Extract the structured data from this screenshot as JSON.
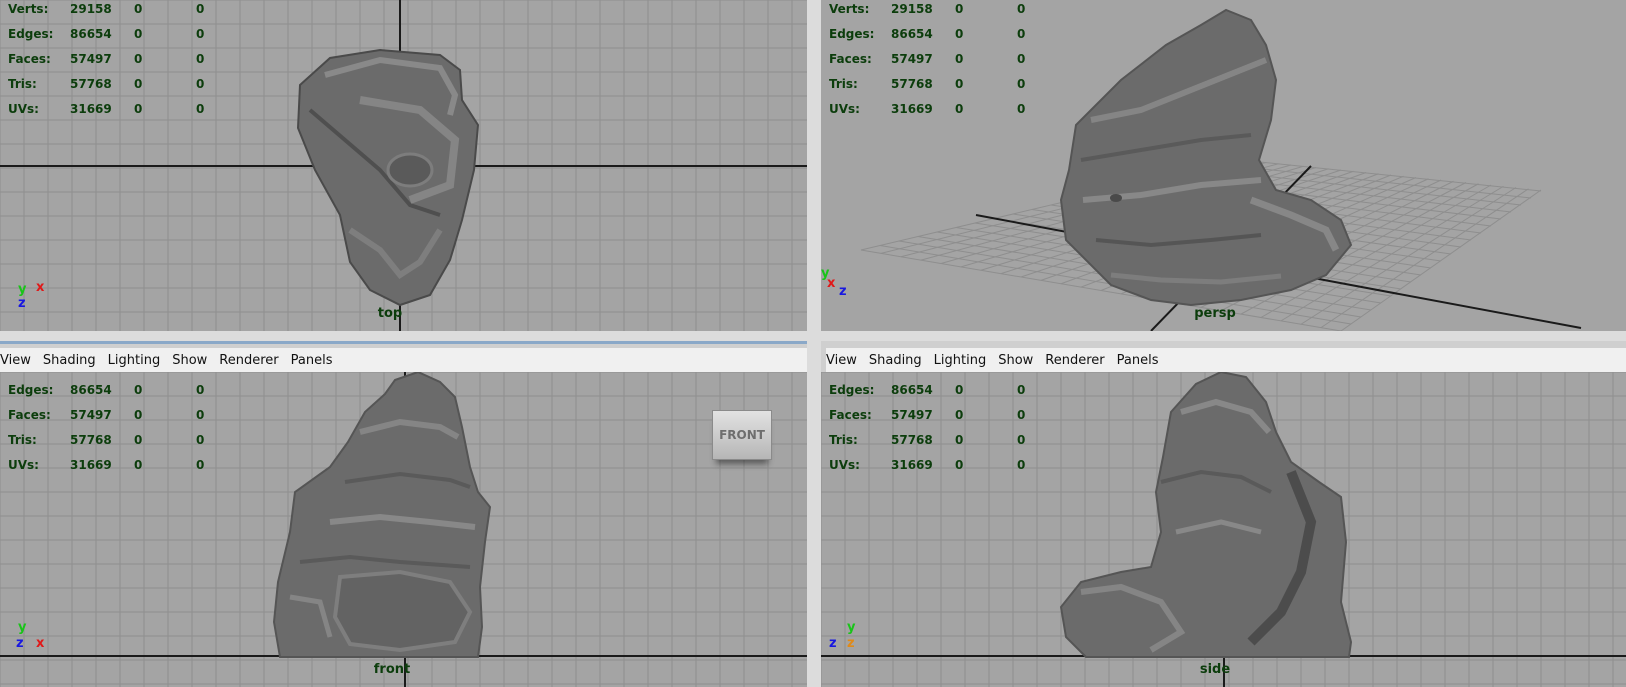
{
  "menu": [
    "View",
    "Shading",
    "Lighting",
    "Show",
    "Renderer",
    "Panels"
  ],
  "stats": [
    {
      "label": "Verts:",
      "v1": "29158",
      "v2": "0",
      "v3": "0"
    },
    {
      "label": "Edges:",
      "v1": "86654",
      "v2": "0",
      "v3": "0"
    },
    {
      "label": "Faces:",
      "v1": "57497",
      "v2": "0",
      "v3": "0"
    },
    {
      "label": "Tris:",
      "v1": "57768",
      "v2": "0",
      "v3": "0"
    },
    {
      "label": "UVs:",
      "v1": "31669",
      "v2": "0",
      "v3": "0"
    }
  ],
  "viewports": {
    "top": {
      "camera": "top",
      "axes": {
        "a": "y",
        "b": "x",
        "c": "z"
      }
    },
    "persp": {
      "camera": "persp",
      "axes": {
        "a": "y",
        "b": "x",
        "c": "z"
      }
    },
    "front": {
      "camera": "front",
      "axes": {
        "a": "y",
        "b": "z",
        "c": "x"
      }
    },
    "side": {
      "camera": "side",
      "axes": {
        "a": "y",
        "b": "z",
        "c": "z"
      }
    }
  },
  "view_cube": {
    "label": "FRONT"
  },
  "colors": {
    "viewport_bg": "#a4a4a4",
    "grid": "#8e8e8e",
    "axis_line": "#1a1a1a",
    "hud_text": "#0c3d0c",
    "mesh": "#6b6b6b"
  }
}
